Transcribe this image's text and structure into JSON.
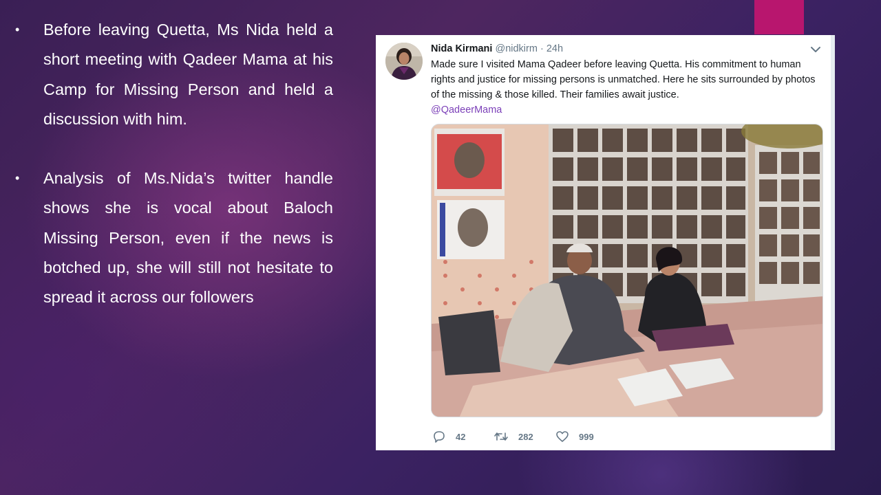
{
  "slide": {
    "accent_color": "#b8166e",
    "bullets": [
      {
        "marker": "•",
        "text": "Before leaving Quetta, Ms Nida held a short meeting with Qadeer Mama at his Camp for Missing Person and held a discussion with him."
      },
      {
        "marker": "•",
        "text": "Analysis of Ms.Nida’s twitter handle shows she is vocal about Baloch Missing Person, even if the news is botched up, she will still not hesitate to spread it across our followers"
      }
    ]
  },
  "tweet": {
    "display_name": "Nida Kirmani",
    "handle": "@nidkirm",
    "separator": "·",
    "time": "24h",
    "text": "Made sure I visited Mama Qadeer before leaving Quetta. His commitment to human rights and justice for missing persons is unmatched. Here he sits surrounded by photos of the missing & those killed. Their families await justice.",
    "mention": "@QadeerMama",
    "icons": {
      "avatar": "avatar",
      "menu": "chevron-down-icon",
      "reply": "reply-icon",
      "retweet": "retweet-icon",
      "like": "heart-icon"
    },
    "counts": {
      "replies": "42",
      "retweets": "282",
      "likes": "999"
    },
    "mention_color": "#7b3fb8"
  }
}
